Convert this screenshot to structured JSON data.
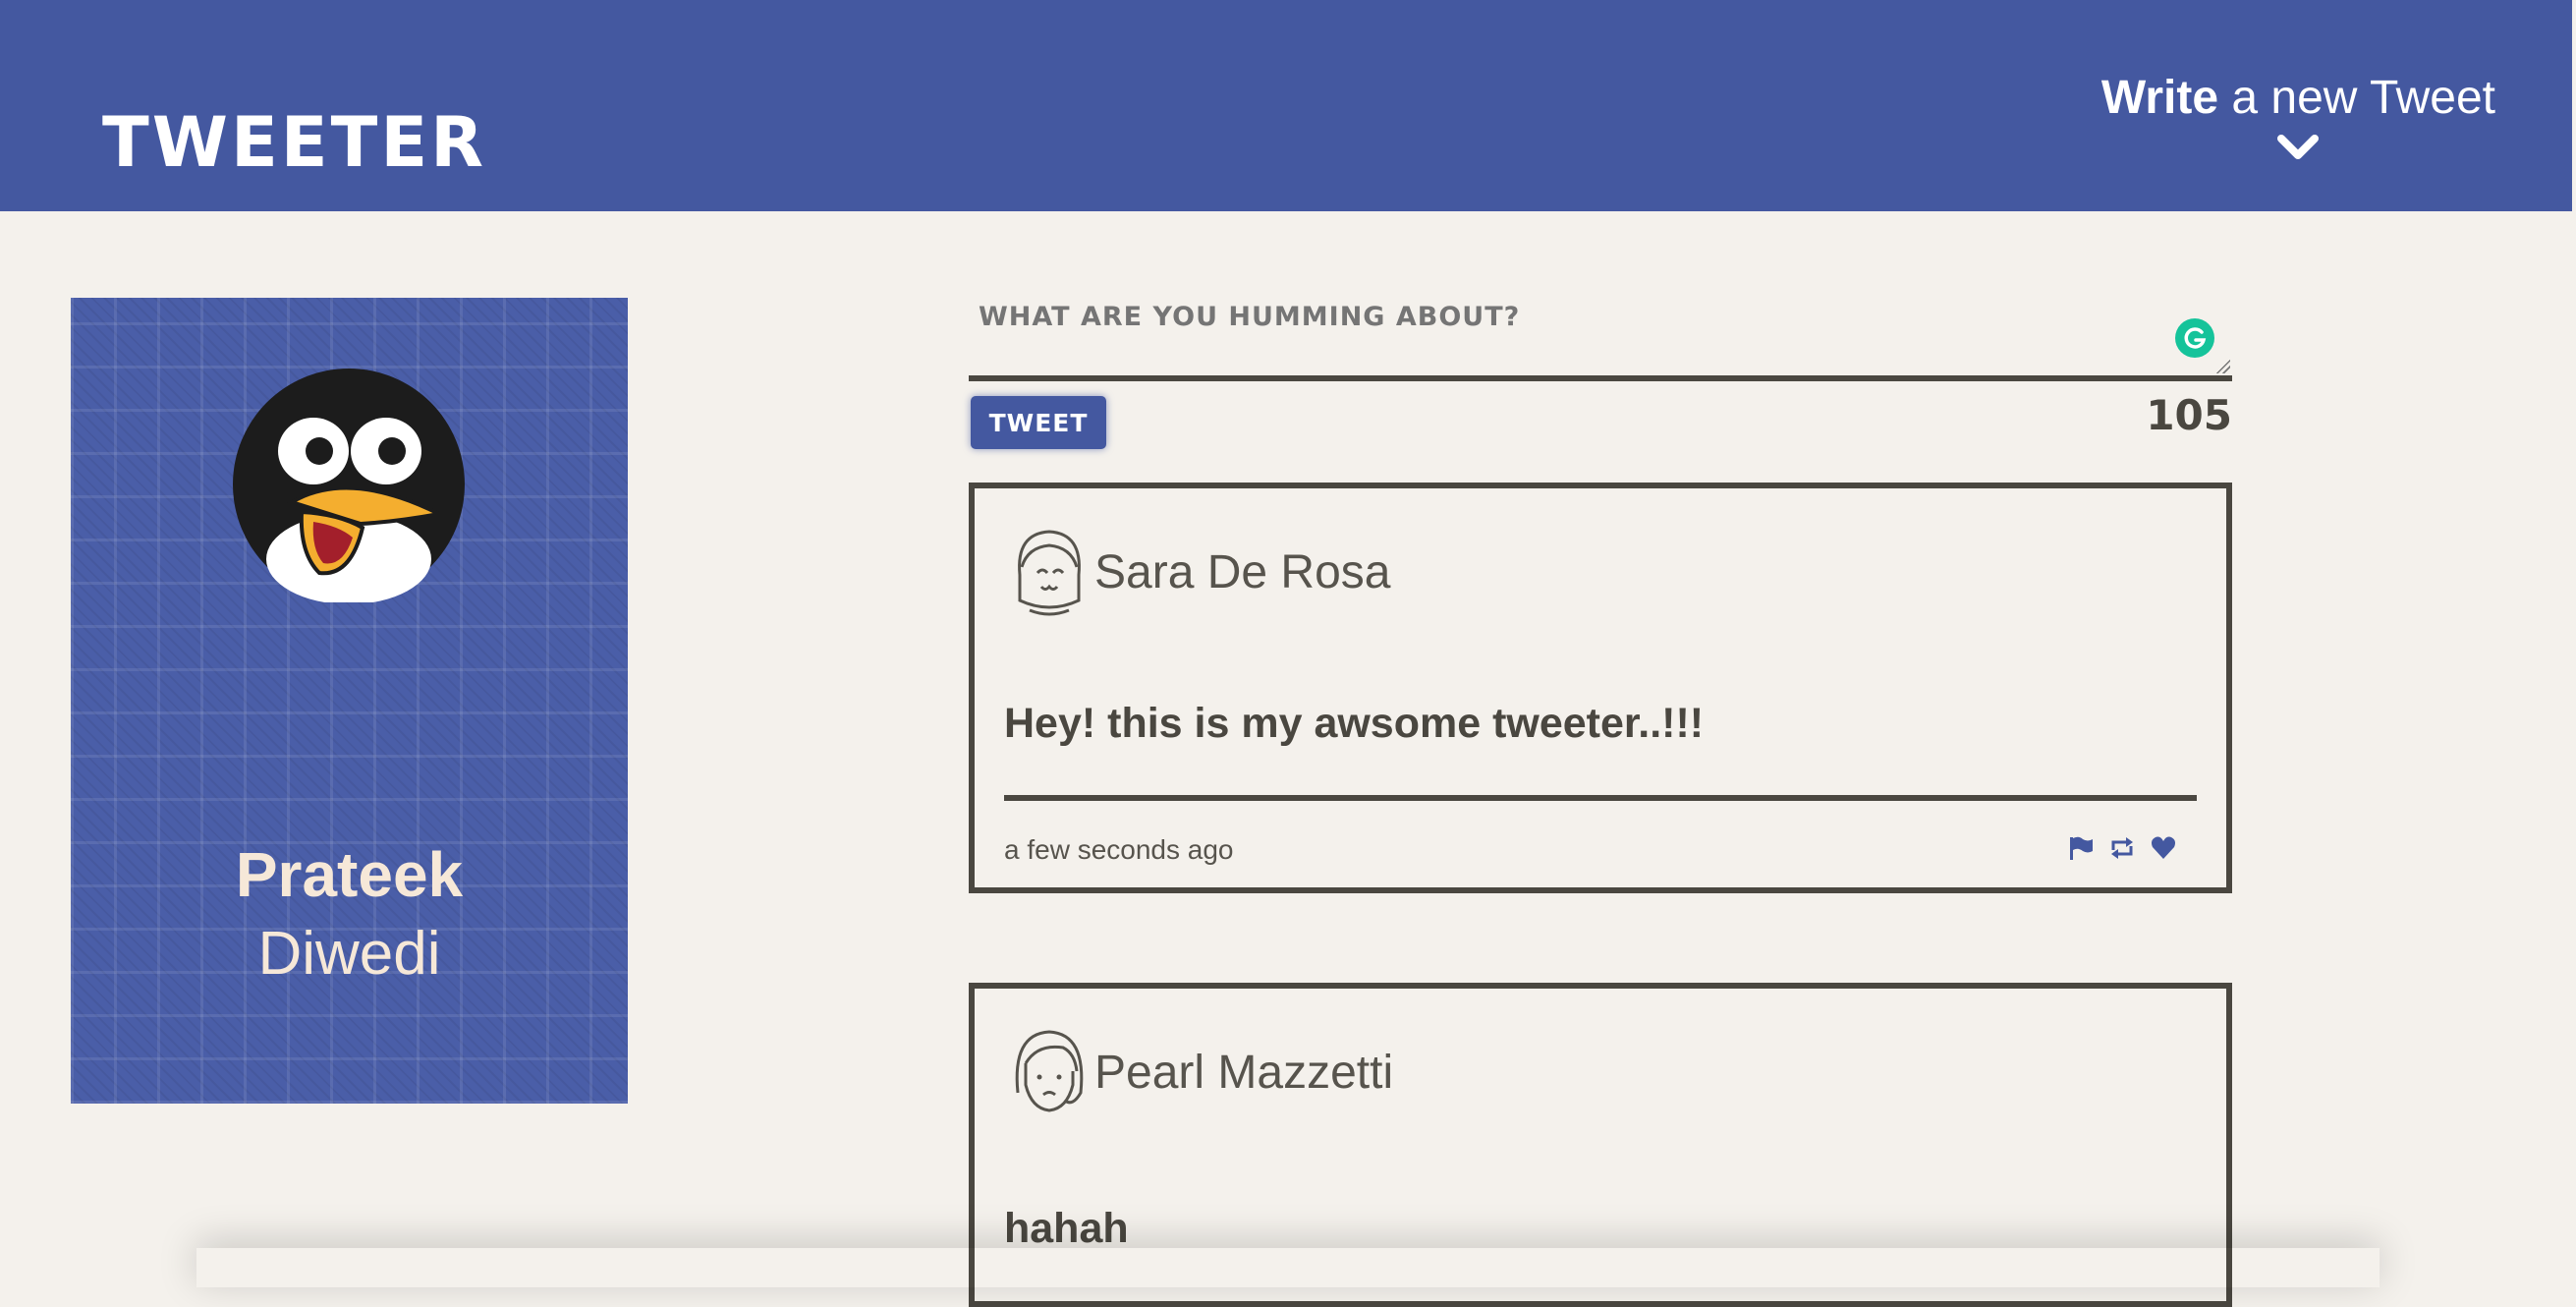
{
  "app": {
    "brand": "TWEETER",
    "compose_toggle": {
      "strong": "Write",
      "rest": " a new Tweet",
      "icon": "chevron-down-icon"
    },
    "colors": {
      "accent": "#4458a0",
      "background": "#f4f1ec",
      "text": "#4a4740"
    }
  },
  "profile": {
    "first_name": "Prateek",
    "last_name": "Diwedi",
    "avatar": "penguin-avatar"
  },
  "composer": {
    "placeholder": "WHAT ARE YOU HUMMING ABOUT?",
    "value": "",
    "button_label": "TWEET",
    "char_counter": "105"
  },
  "tweets": [
    {
      "author": "Sara De Rosa",
      "content": "Hey! this is my awsome tweeter..!!!",
      "timestamp": "a few seconds ago",
      "actions": [
        "flag-icon",
        "retweet-icon",
        "heart-icon"
      ]
    },
    {
      "author": "Pearl Mazzetti",
      "content": "hahah"
    }
  ]
}
